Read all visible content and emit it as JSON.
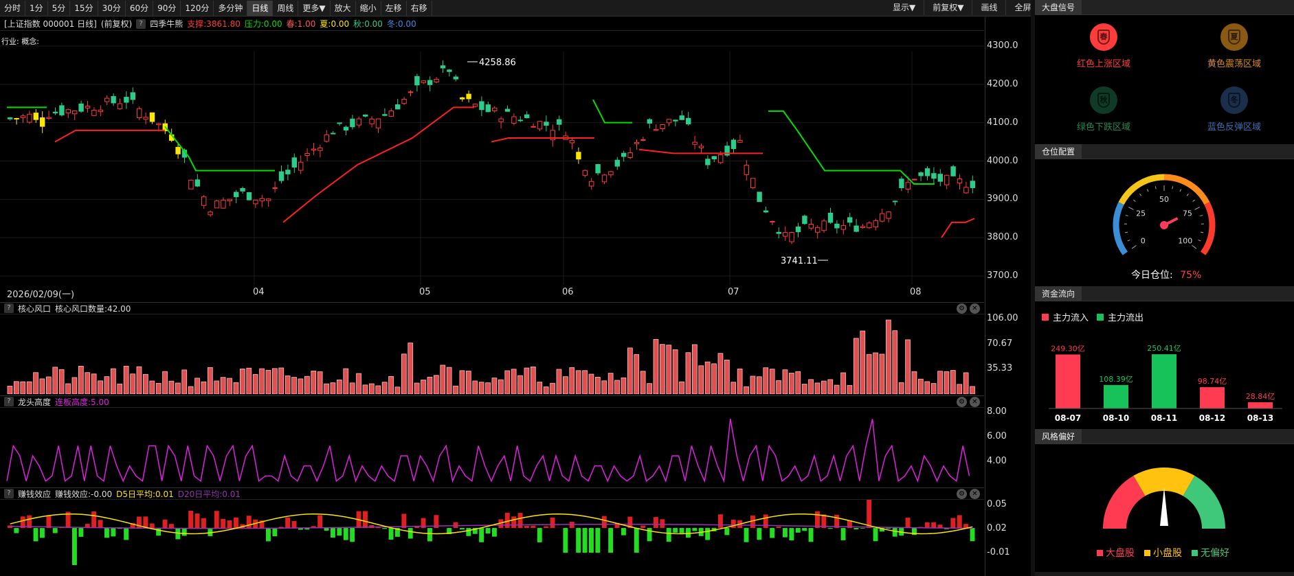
{
  "toolbar": {
    "periods": [
      "分时",
      "1分",
      "5分",
      "15分",
      "30分",
      "60分",
      "90分",
      "120分",
      "多分钟",
      "日线",
      "周线",
      "更多▼",
      "放大",
      "缩小",
      "左移",
      "右移"
    ],
    "active": "日线",
    "right": [
      "显示▼",
      "前复权▼",
      "画线",
      "全屏"
    ]
  },
  "info": {
    "prefix": "[上证指数 000001 日线]",
    "adjust": "(前复权)",
    "q": "?",
    "indicator": "四季牛熊",
    "support": "支撑:3861.80",
    "pressure": "压力:0.00",
    "spring": "春:1.00",
    "summer": "夏:0.00",
    "autumn": "秋:0.00",
    "winter": "冬:0.00"
  },
  "industry": "行业: 概念:",
  "price_axis": [
    "4300.0",
    "4200.0",
    "4100.0",
    "4000.0",
    "3900.0",
    "3800.0",
    "3700.0"
  ],
  "annot": {
    "high": "4258.86",
    "low": "3741.11"
  },
  "x_labels": {
    "date": "2026/02/09(一)",
    "m1": "04",
    "m2": "05",
    "m3": "06",
    "m4": "07",
    "m5": "08"
  },
  "panel1": {
    "q": "?",
    "name": "核心风口",
    "value": "核心风口数量:42.00",
    "axis": [
      "106.00",
      "70.67",
      "35.33"
    ]
  },
  "panel2": {
    "q": "?",
    "name": "龙头高度",
    "value": "连板高度:5.00",
    "axis": [
      "8.00",
      "6.00",
      "4.00"
    ]
  },
  "panel3": {
    "q": "?",
    "name": "赚钱效应",
    "value": "赚钱效应:-0.00",
    "d5": "D5日平均:0.01",
    "d20": "D20日平均:0.01",
    "axis": [
      "0.05",
      "0.02",
      "-0.01"
    ]
  },
  "icons": {
    "gear": "gear-icon",
    "close": "close-icon",
    "gear_glyph": "⚙",
    "close_glyph": "✕"
  },
  "colors": {
    "up": "#ff3b3b",
    "down": "#2ecc8a",
    "yellow": "#ffe600",
    "green_line": "#00e000",
    "red_line": "#ff2020",
    "magenta": "#e020e0",
    "accent": "#ff4444"
  },
  "right": {
    "signal_title": "大盘信号",
    "seasons": [
      {
        "glyph": "春",
        "label": "红色上涨区域",
        "color": "#ff3b3b",
        "bg": "#ff3b3b"
      },
      {
        "glyph": "夏",
        "label": "黄色震荡区域",
        "color": "#d98b14",
        "bg": "#8a5a12"
      },
      {
        "glyph": "秋",
        "label": "绿色下跌区域",
        "color": "#1f8a55",
        "bg": "#0f3a28"
      },
      {
        "glyph": "冬",
        "label": "蓝色反弹区域",
        "color": "#3d6fb0",
        "bg": "#1b2f4c"
      }
    ],
    "position_title": "仓位配置",
    "gauge": {
      "ticks": [
        "0",
        "25",
        "50",
        "75",
        "100"
      ],
      "label": "今日仓位:",
      "value": "75%",
      "level": 0.75
    },
    "flow_title": "资金流向",
    "flow_legend": {
      "in": "主力流入",
      "out": "主力流出"
    },
    "flow_data": [
      {
        "date": "08-07",
        "value": "249.30亿",
        "v": 249.3,
        "type": "in"
      },
      {
        "date": "08-10",
        "value": "108.39亿",
        "v": 108.39,
        "type": "out"
      },
      {
        "date": "08-11",
        "value": "250.41亿",
        "v": 250.41,
        "type": "out"
      },
      {
        "date": "08-12",
        "value": "98.74亿",
        "v": 98.74,
        "type": "in"
      },
      {
        "date": "08-13",
        "value": "28.84亿",
        "v": 28.84,
        "type": "in"
      }
    ],
    "style_title": "风格偏好",
    "style_legend": [
      {
        "label": "大盘股",
        "color": "#ff3b52"
      },
      {
        "label": "小盘股",
        "color": "#ffc20e"
      },
      {
        "label": "无偏好",
        "color": "#3fc77a"
      }
    ],
    "style_level": 0.5
  },
  "chart_data": {
    "type": "candlestick",
    "title": "上证指数 000001 日线",
    "ylim": [
      3680,
      4320
    ],
    "annotations": [
      {
        "label": "4258.86",
        "value": 4258.86
      },
      {
        "label": "3741.11",
        "value": 3741.11
      }
    ],
    "x_ticks": [
      "2026/02/09(一)",
      "04",
      "05",
      "06",
      "07",
      "08"
    ],
    "series": [
      {
        "name": "核心风口数量",
        "last": 42.0
      },
      {
        "name": "连板高度",
        "last": 5.0
      },
      {
        "name": "赚钱效应",
        "last": -0.0
      },
      {
        "name": "D5日平均",
        "last": 0.01
      },
      {
        "name": "D20日平均",
        "last": 0.01
      }
    ]
  }
}
